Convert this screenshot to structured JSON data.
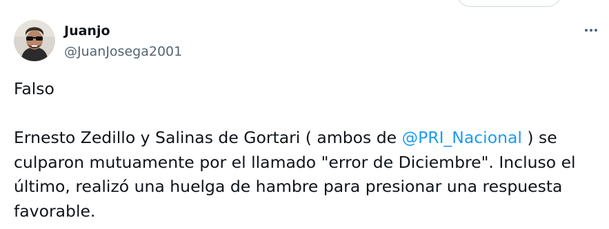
{
  "author": {
    "display_name": "Juanjo",
    "handle": "@JuanJosega2001"
  },
  "menu": {
    "icon": "more-horizontal-icon"
  },
  "tweet": {
    "line1": "Falso",
    "para_prefix": "Ernesto Zedillo y Salinas de Gortari ( ambos de ",
    "mention": "@PRI_Nacional",
    "para_suffix": " ) se culparon mutuamente por el llamado \"error de Diciembre\". Incluso el último, realizó una huelga de hambre para presionar una respuesta favorable."
  },
  "colors": {
    "text": "#0f1419",
    "secondary": "#536471",
    "link": "#1d9bf0"
  }
}
